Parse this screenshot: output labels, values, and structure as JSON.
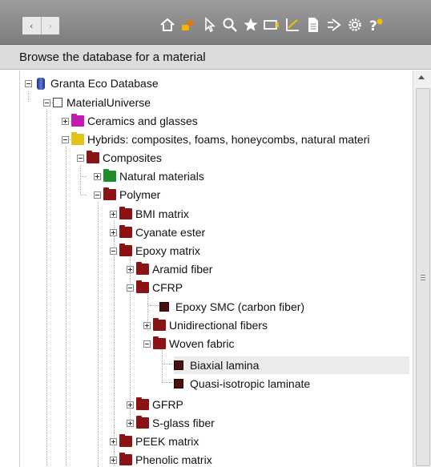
{
  "toolbar": {
    "nav_back": "‹",
    "nav_forward": "›",
    "icons": [
      "home-icon",
      "tools-icon",
      "cursor-icon",
      "search-icon",
      "star-icon",
      "window-icon",
      "chart-icon",
      "document-icon",
      "arrow-icon",
      "settings-icon",
      "help-icon"
    ]
  },
  "panel": {
    "caption": "Browse the database for a material"
  },
  "tree": [
    {
      "label": "Granta Eco Database"
    },
    {
      "label": "MaterialUniverse"
    },
    {
      "label": "Ceramics and glasses"
    },
    {
      "label": "Hybrids: composites, foams, honeycombs, natural materi"
    },
    {
      "label": "Composites"
    },
    {
      "label": "Natural materials"
    },
    {
      "label": "Polymer"
    },
    {
      "label": "BMI matrix"
    },
    {
      "label": "Cyanate ester"
    },
    {
      "label": "Epoxy matrix"
    },
    {
      "label": "Aramid fiber"
    },
    {
      "label": "CFRP"
    },
    {
      "label": "Epoxy SMC (carbon fiber)"
    },
    {
      "label": "Unidirectional fibers"
    },
    {
      "label": "Woven fabric"
    },
    {
      "label": "Biaxial lamina"
    },
    {
      "label": "Quasi-isotropic laminate"
    },
    {
      "label": "GFRP"
    },
    {
      "label": "S-glass fiber"
    },
    {
      "label": "PEEK matrix"
    },
    {
      "label": "Phenolic matrix"
    }
  ]
}
